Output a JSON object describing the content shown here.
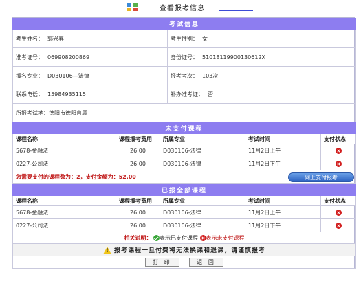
{
  "header": {
    "title": "查看报考信息"
  },
  "exam_info": {
    "section_title": "考试信息",
    "name_label": "考生姓名：",
    "name": "郭兴春",
    "gender_label": "考生性别：",
    "gender": "女",
    "admission_label": "准考证号：",
    "admission_no": "069908200869",
    "id_label": "身份证号：",
    "id_no": "51018119900130612X",
    "major_label": "报名专业：",
    "major": "D030106—法律",
    "times_label": "报考考次：",
    "times": "103次",
    "phone_label": "联系电话：",
    "phone": "15984935115",
    "reissue_label": "补办准考证：",
    "reissue": "否",
    "site_label": "所报考试地：",
    "site": "德阳市德阳直属"
  },
  "columns": {
    "course_name": "课程名称",
    "fee": "课程报考费用",
    "major": "所属专业",
    "exam_time": "考试时间",
    "pay_status": "支付状态"
  },
  "unpaid": {
    "section_title": "未支付课程",
    "rows": [
      {
        "name": "5678-金融法",
        "fee": "26.00",
        "major": "D030106-法律",
        "time": "11月2日上午"
      },
      {
        "name": "0227-公司法",
        "fee": "26.00",
        "major": "D030106-法律",
        "time": "11月2日下午"
      }
    ],
    "due_text": "您需要支付的课程数为：2，支付金额为：52.00",
    "pay_button": "网上支付报考"
  },
  "all_courses": {
    "section_title": "已报全部课程",
    "rows": [
      {
        "name": "5678-金融法",
        "fee": "26.00",
        "major": "D030106-法律",
        "time": "11月2日上午"
      },
      {
        "name": "0227-公司法",
        "fee": "26.00",
        "major": "D030106-法律",
        "time": "11月2日下午"
      }
    ]
  },
  "legend": {
    "title": "相关说明：",
    "paid_text": "表示已支付课程",
    "unpaid_text": "表示未支付课程"
  },
  "warning": "报考课程一旦付费将无法换课和退课，请谨慎报考",
  "buttons": {
    "print": "打 印",
    "back": "返 回"
  },
  "colors": {
    "section_header": "#8d7df0",
    "alert_red": "#c01818",
    "pay_button": "#2d64c2"
  }
}
